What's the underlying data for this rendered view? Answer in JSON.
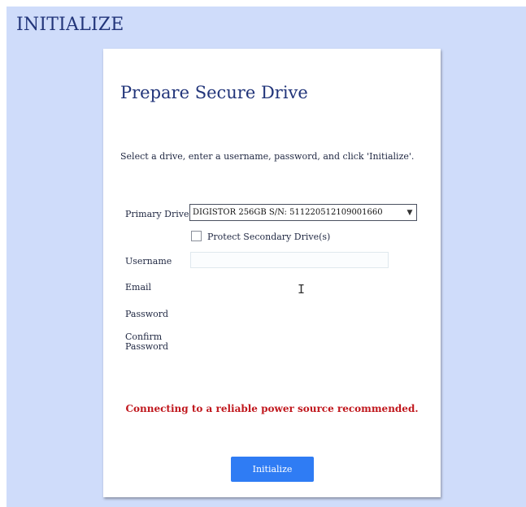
{
  "page": {
    "heading": "INITIALIZE"
  },
  "card": {
    "title": "Prepare Secure Drive",
    "instructions": "Select a drive, enter a username, password, and click 'Initialize'.",
    "primary_drive": {
      "label": "Primary Drive",
      "selected": "DIGISTOR 256GB S/N: 511220512109001660"
    },
    "protect_secondary": {
      "label": "Protect Secondary Drive(s)",
      "checked": false
    },
    "fields": {
      "username_label": "Username",
      "email_label": "Email",
      "password_label": "Password",
      "confirm_label_line1": "Confirm",
      "confirm_label_line2": "Password"
    },
    "warning": "Connecting to a reliable power source recommended.",
    "initialize_button": "Initialize"
  },
  "colors": {
    "page_background": "#cfdcfa",
    "heading": "#22357a",
    "warning": "#c0171d",
    "button": "#2f7cf4"
  },
  "icons": {
    "select_arrow": "chevron-down-icon",
    "cursor": "text-cursor-icon"
  }
}
